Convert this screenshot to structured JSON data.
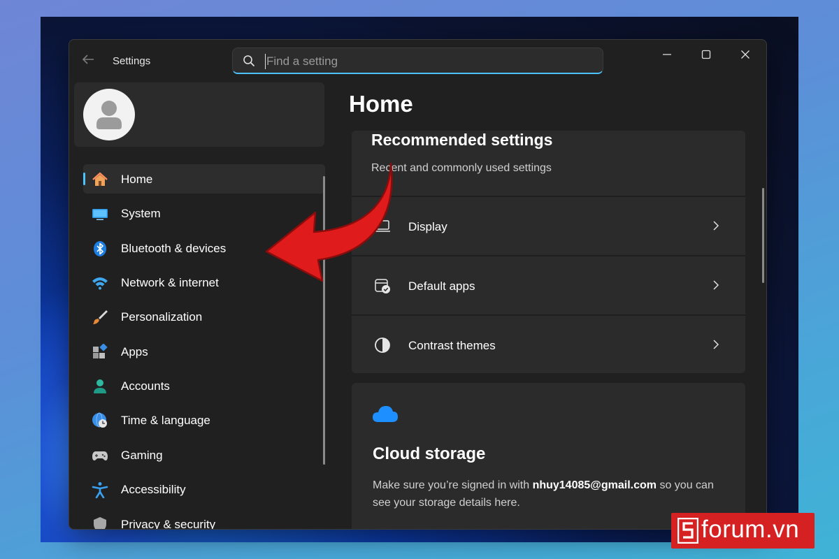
{
  "window": {
    "title": "Settings",
    "search_placeholder": "Find a setting"
  },
  "sidebar": {
    "items": [
      {
        "label": "Home",
        "icon": "home-icon",
        "active": true
      },
      {
        "label": "System",
        "icon": "system-icon"
      },
      {
        "label": "Bluetooth & devices",
        "icon": "bluetooth-icon"
      },
      {
        "label": "Network & internet",
        "icon": "wifi-icon"
      },
      {
        "label": "Personalization",
        "icon": "brush-icon"
      },
      {
        "label": "Apps",
        "icon": "apps-icon"
      },
      {
        "label": "Accounts",
        "icon": "account-icon"
      },
      {
        "label": "Time & language",
        "icon": "globe-clock-icon"
      },
      {
        "label": "Gaming",
        "icon": "gamepad-icon"
      },
      {
        "label": "Accessibility",
        "icon": "accessibility-icon"
      },
      {
        "label": "Privacy & security",
        "icon": "shield-icon"
      }
    ]
  },
  "main": {
    "title": "Home",
    "recommended": {
      "title": "Recommended settings",
      "subtitle": "Recent and commonly used settings",
      "rows": [
        {
          "label": "Display",
          "icon": "display-icon"
        },
        {
          "label": "Default apps",
          "icon": "default-apps-icon"
        },
        {
          "label": "Contrast themes",
          "icon": "contrast-icon"
        }
      ]
    },
    "cloud": {
      "title": "Cloud storage",
      "desc_before": "Make sure you’re signed in with ",
      "email": "nhuy14085@gmail.com",
      "desc_after": " so you can see your storage details here."
    }
  },
  "watermark": {
    "text": "forum.vn"
  },
  "colors": {
    "accent": "#4cc2ff",
    "window_bg": "#202020",
    "card_bg": "#2b2b2b",
    "arrow": "#e01b1b",
    "watermark_bg": "#d52121"
  }
}
